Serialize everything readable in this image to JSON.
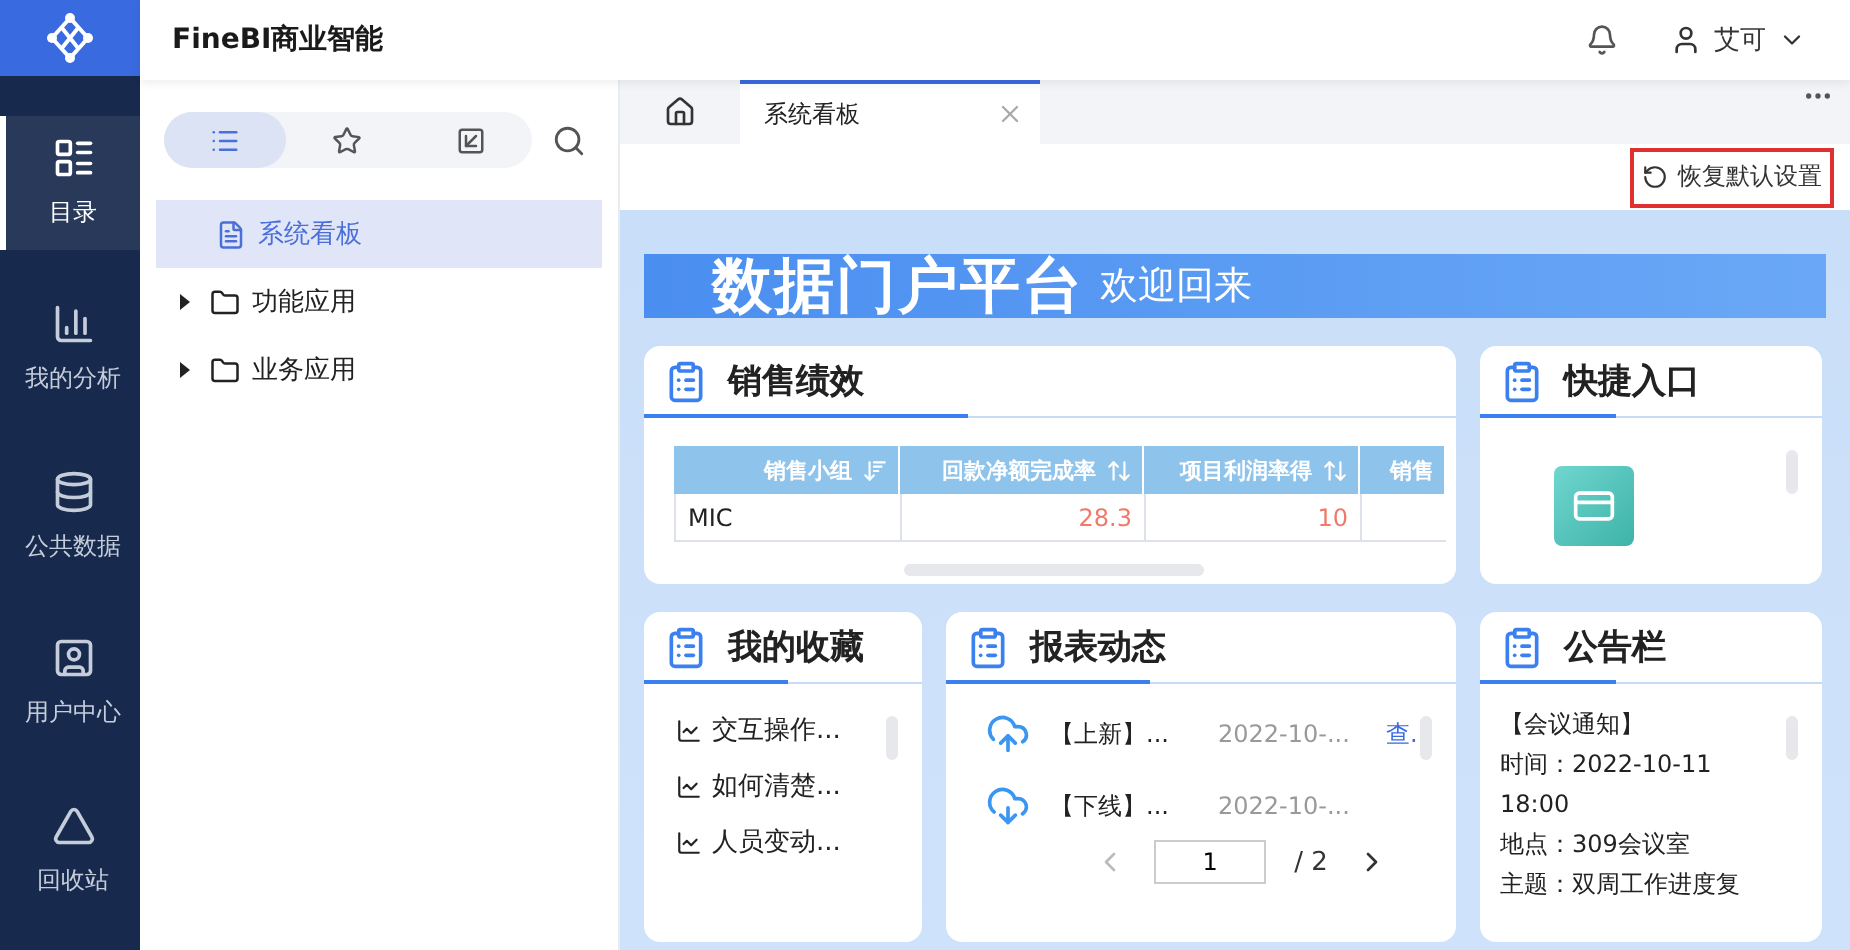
{
  "header": {
    "title": "FineBI商业智能",
    "user": "艾可"
  },
  "nav": [
    {
      "label": "目录",
      "kind": "catalog",
      "selected": true
    },
    {
      "label": "我的分析",
      "kind": "analysis",
      "selected": false
    },
    {
      "label": "公共数据",
      "kind": "data",
      "selected": false
    },
    {
      "label": "用户中心",
      "kind": "user",
      "selected": false
    },
    {
      "label": "回收站",
      "kind": "trash",
      "selected": false
    }
  ],
  "sidebar": {
    "tabs": [
      {
        "kind": "list",
        "selected": true
      },
      {
        "kind": "star",
        "selected": false
      },
      {
        "kind": "import",
        "selected": false
      }
    ],
    "tree": [
      {
        "label": "系统看板",
        "kind": "file",
        "selected": true
      },
      {
        "label": "功能应用",
        "kind": "folder",
        "selected": false,
        "expanded": false
      },
      {
        "label": "业务应用",
        "kind": "folder",
        "selected": false,
        "expanded": false
      }
    ]
  },
  "tabs": [
    {
      "label": "系统看板",
      "selected": true
    }
  ],
  "toolbar": {
    "restore": "恢复默认设置"
  },
  "banner": {
    "title": "数据门户平台",
    "subtitle": "欢迎回来"
  },
  "sales": {
    "title": "销售绩效",
    "columns": [
      {
        "label": "销售小组",
        "kind": "sort-desc"
      },
      {
        "label": "回款净额完成率",
        "kind": "sort-both"
      },
      {
        "label": "项目利润率得",
        "kind": "sort-both"
      },
      {
        "label": "销售",
        "kind": "plain"
      }
    ],
    "rows": [
      [
        "MIC",
        "28.3",
        "10"
      ]
    ]
  },
  "shortcuts": {
    "title": "快捷入口"
  },
  "favorites": {
    "title": "我的收藏",
    "items": [
      "交互操作...",
      "如何清楚...",
      "人员变动..."
    ]
  },
  "reports": {
    "title": "报表动态",
    "items": [
      {
        "kind": "up",
        "label": "【上新】...",
        "date": "2022-10-...",
        "link": "查."
      },
      {
        "kind": "down",
        "label": "【下线】...",
        "date": "2022-10-..."
      }
    ],
    "page": "1",
    "pages": "/ 2"
  },
  "notice": {
    "title": "公告栏",
    "lines": [
      "【会议通知】",
      "时间：2022-10-11 18:00",
      "地点：309会议室",
      "主题：双周工作进度复"
    ]
  }
}
